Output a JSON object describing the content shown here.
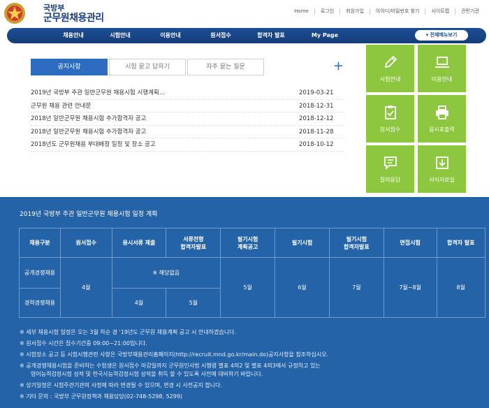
{
  "header": {
    "brand_sub": "국방부",
    "brand_main": "군무원채용관리",
    "utility_links": [
      "Home",
      "로그인",
      "회원가입",
      "아이디/비밀번호 찾기",
      "사이트맵",
      "관련기관"
    ]
  },
  "nav": {
    "items": [
      "채용안내",
      "시험안내",
      "이용안내",
      "원서접수",
      "합격자 발표",
      "My Page"
    ],
    "all_menu_label": "▾ 전체메뉴보기"
  },
  "notice": {
    "tabs": [
      "공지사항",
      "시험 묻고 답하기",
      "자주 묻는 질문"
    ],
    "active_tab": 0,
    "plus_label": "+",
    "items": [
      {
        "title": "2019년 국방부 주관 일반군무원 채용시험 시행계획...",
        "date": "2019-03-21"
      },
      {
        "title": "군무원 채용 관련 안내문",
        "date": "2018-12-31"
      },
      {
        "title": "2018년 일반군무원 채용시험 추가합격자 공고",
        "date": "2018-12-12"
      },
      {
        "title": "2018년 일반군무원 채용시험 추가합격자 공고",
        "date": "2018-11-28"
      },
      {
        "title": "2018년도 군무원채용 부대배정 일정 및 장소 공고",
        "date": "2018-10-12"
      }
    ]
  },
  "tiles": [
    {
      "label": "시험안내",
      "icon": "pencil-icon"
    },
    {
      "label": "이용안내",
      "icon": "laptop-icon"
    },
    {
      "label": "원서접수",
      "icon": "clipboard-check-icon"
    },
    {
      "label": "응시표출력",
      "icon": "printer-icon"
    },
    {
      "label": "질의응답",
      "icon": "chat-icon"
    },
    {
      "label": "서식자료실",
      "icon": "download-icon"
    }
  ],
  "schedule": {
    "title": "2019년 국방부 주관 일반군무원 채용시험 일정 계획",
    "headers": {
      "category": "채용구분",
      "application": "원서접수",
      "doc_submit": "응시서류 제출",
      "doc_pass": "서류전형\n합격자발표",
      "written_notice": "필기시험\n계획공고",
      "written": "필기시험",
      "written_pass": "필기시험\n합격자발표",
      "interview": "면접시험",
      "final": "합격자 발표"
    },
    "rows": {
      "open_label": "공개경쟁채용",
      "career_label": "경력경쟁채용",
      "application": "4월",
      "open_doc": "※ 해당없음",
      "career_doc_submit": "4월",
      "career_doc_pass": "5월",
      "written_notice": "5월",
      "written": "6월",
      "written_pass": "7월",
      "interview": "7월~8월",
      "final": "8월"
    },
    "notes": [
      "※ 세부 채용시험 일정은 오는 3월 하순 경 '19년도 군무원 채용계획 공고 시 안내하겠습니다.",
      "※ 원서접수 시간은 접수기간중 09:00~21:00입니다.",
      "※ 시험장소 공고 등 시험시행관련 사항은 국방부채용관리홈페이지(http://recruit.mnd.go.kr/main.do)공지사항을 참조하십시오.",
      "※ 공개경쟁채용시험을 준비하는 수험생은 원서접수 마감일까지 군무원인사법 시행령 별표 4의2 및 별표 4의3에서 규정하고 있는",
      "영어능력검정시험 성적 및 한국사능력검정시험 성적을 취득 할 수 있도록 사전에 대비하기 바랍니다.",
      "※ 상기일정은 시험주관기관의 사정에 따라 변경될 수 있으며, 변경 시 사전공지 합니다.",
      "※ 기타 문의 : 국방부 군무원정책과 채용담당(02-748-5298, 5299)"
    ]
  },
  "colors": {
    "brand_navy": "#1a3e7a",
    "nav_blue": "#1c4f96",
    "tab_active": "#2d6cc0",
    "tile_green": "#8dc63f",
    "schedule_bg": "#2563a8"
  }
}
